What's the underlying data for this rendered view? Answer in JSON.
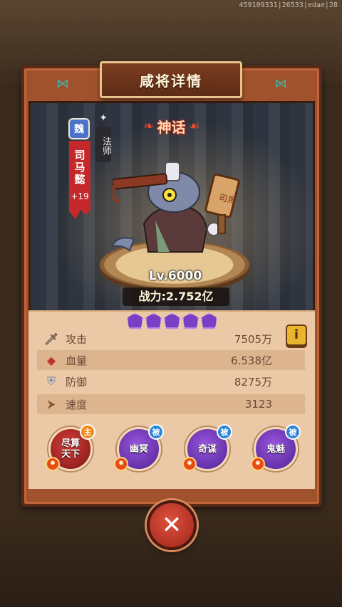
{
  "debug": "459109331|26533|edae|28",
  "title": "咸将详情",
  "hero": {
    "kingdom": "魏",
    "class_label": "法师",
    "name": "司马懿",
    "bonus": "+19",
    "rarity": "神话",
    "level": "Lv.6000",
    "power": "战力:2.752亿",
    "stars": 5
  },
  "stats": [
    {
      "icon": "sword-icon",
      "label": "攻击",
      "value": "7505万"
    },
    {
      "icon": "blood-icon",
      "label": "血量",
      "value": "6.538亿"
    },
    {
      "icon": "shield-icon",
      "label": "防御",
      "value": "8275万"
    },
    {
      "icon": "boot-icon",
      "label": "速度",
      "value": "3123"
    }
  ],
  "info_button": "i",
  "skills": [
    {
      "name": "尽算\n天下",
      "tag": "主",
      "type": "active"
    },
    {
      "name": "幽冥",
      "tag": "被",
      "type": "passive"
    },
    {
      "name": "奇谋",
      "tag": "被",
      "type": "passive"
    },
    {
      "name": "鬼魅",
      "tag": "被",
      "type": "passive"
    }
  ],
  "colors": {
    "frame": "#a0522d",
    "panel": "#ecc9a6",
    "active_skill": "#c2302a",
    "passive_skill": "#7a3fc4",
    "rarity_red": "#e04a2a"
  }
}
